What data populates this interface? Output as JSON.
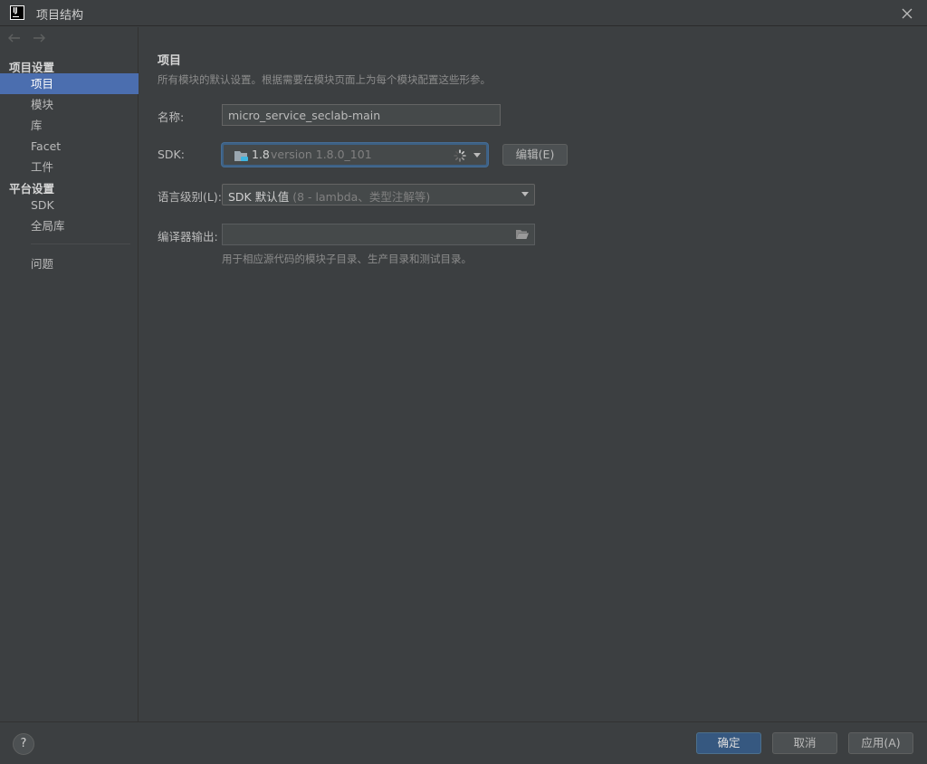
{
  "window": {
    "title": "项目结构",
    "logo_text": "IJ"
  },
  "sidebar": {
    "project_settings_header": "项目设置",
    "platform_settings_header": "平台设置",
    "items": {
      "project": "项目",
      "modules": "模块",
      "libraries": "库",
      "facet": "Facet",
      "artifacts": "工件",
      "sdk": "SDK",
      "global_libraries": "全局库",
      "problems": "问题"
    },
    "selected": "项目"
  },
  "main": {
    "title": "项目",
    "description": "所有模块的默认设置。根据需要在模块页面上为每个模块配置这些形参。",
    "name_label": "名称:",
    "name_value": "micro_service_seclab-main",
    "sdk_label": "SDK:",
    "sdk_name": "1.8",
    "sdk_version": "version 1.8.0_101",
    "edit_button": "编辑(E)",
    "language_level_label": "语言级别(L):",
    "language_level_value": "SDK 默认值",
    "language_level_detail": "(8 - lambda、类型注解等)",
    "compiler_output_label": "编译器输出:",
    "compiler_output_value": "",
    "compiler_output_hint": "用于相应源代码的模块子目录、生产目录和测试目录。"
  },
  "footer": {
    "help": "?",
    "ok": "确定",
    "cancel": "取消",
    "apply": "应用(A)"
  },
  "colors": {
    "background": "#3c3f41",
    "selection": "#4b6eaf",
    "primary_button": "#365880",
    "focus_border": "#3d6185"
  }
}
